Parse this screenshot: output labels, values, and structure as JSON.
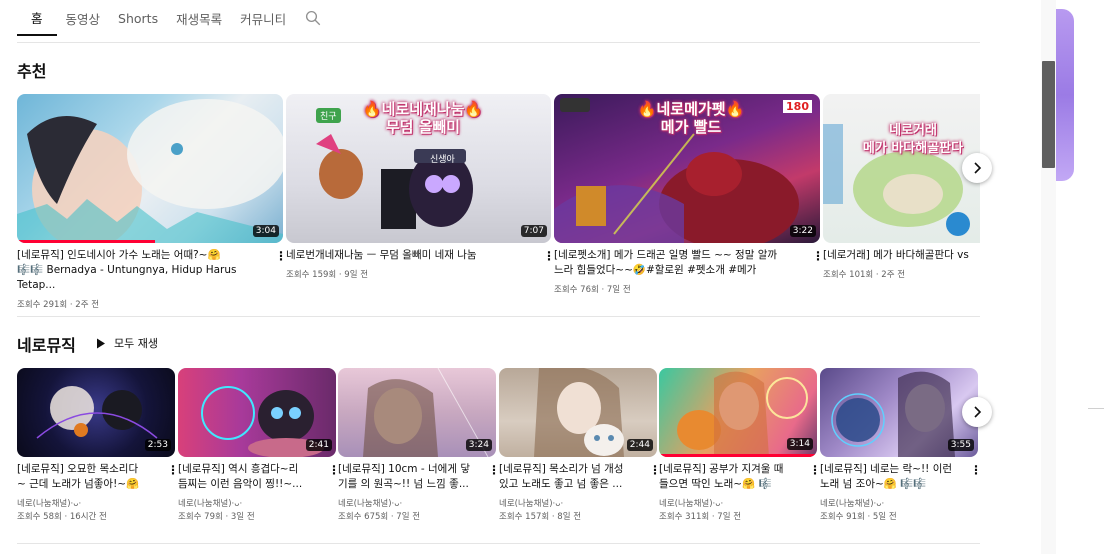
{
  "tabs": [
    {
      "label": "홈",
      "active": true
    },
    {
      "label": "동영상",
      "active": false
    },
    {
      "label": "Shorts",
      "active": false
    },
    {
      "label": "재생목록",
      "active": false
    },
    {
      "label": "커뮤니티",
      "active": false
    }
  ],
  "search_icon": "search-icon",
  "recommended": {
    "title": "추천",
    "videos": [
      {
        "title_line1": "[네로뮤직] 인도네시아 가수 노래는 어때?~🤗",
        "title_line2": "🎼🎼 Bernadya - Untungnya, Hidup Harus Tetap...",
        "meta": "조회수 291회 · 2주 전",
        "duration": "3:04",
        "progress": 0.52
      },
      {
        "title_line1": "네로번개네재나눔 ㅡ 무덤 올빼미 네재 나눔",
        "title_line2": "",
        "meta": "조회수 159회 · 9일 전",
        "duration": "7:07",
        "overlay": "🔥네로네재나눔🔥\n무덤 올빼미",
        "tags": [
          "친구",
          "신생아"
        ]
      },
      {
        "title_line1": "[네로펫소개] 메가 드래곤 일명 빨드 ~~ 정말 알까",
        "title_line2": "느라 힘들었다~~🤣#할로윈 #펫소개 #메가",
        "meta": "조회수 76회 · 7일 전",
        "duration": "3:22",
        "overlay": "🔥네로메가펫🔥\n메가 빨드",
        "counter": "180"
      },
      {
        "title_line1": "[네로거래] 메가 바다해골판다 vs",
        "title_line2": "",
        "meta": "조회수 101회 · 2주 전",
        "overlay": "네로거래\n메가 바다해골판다"
      }
    ]
  },
  "playlist": {
    "title": "네로뮤직",
    "play_all": "모두 재생",
    "videos": [
      {
        "title_line1": "[네로뮤직] 오묘한 목소리다",
        "title_line2": "~ 근데 노래가 넘좋아!~🤗",
        "channel": "네로(나눔채널)·ᴗ·",
        "meta": "조회수 58회 · 16시간 전",
        "duration": "2:53"
      },
      {
        "title_line1": "[네로뮤직] 역시 흥겹다~리",
        "title_line2": "듬찌는 이런 음악이 찡!!~...",
        "channel": "네로(나눔채널)·ᴗ·",
        "meta": "조회수 79회 · 3일 전",
        "duration": "2:41"
      },
      {
        "title_line1": "[네로뮤직] 10cm - 너에게 닿",
        "title_line2": "기를 의 원곡~!! 넘 느낌 좋...",
        "channel": "네로(나눔채널)·ᴗ·",
        "meta": "조회수 675회 · 7일 전",
        "duration": "3:24"
      },
      {
        "title_line1": "[네로뮤직] 목소리가 넘 개성",
        "title_line2": "있고 노래도 좋고 넘 좋은 ...",
        "channel": "네로(나눔채널)·ᴗ·",
        "meta": "조회수 157회 · 8일 전",
        "duration": "2:44"
      },
      {
        "title_line1": "[네로뮤직] 공부가 지겨울 때",
        "title_line2": "들으면 딱인 노래~🤗 🎼",
        "channel": "네로(나눔채널)·ᴗ·",
        "meta": "조회수 311회 · 7일 전",
        "duration": "3:14"
      },
      {
        "title_line1": "[네로뮤직] 네로는 락~!! 이런",
        "title_line2": "노래 넘 조아~🤗 🎼🎼",
        "channel": "네로(나눔채널)·ᴗ·",
        "meta": "조회수 91회 · 5일 전",
        "duration": "3:55"
      }
    ]
  },
  "colors": {
    "accent": "#ff0033",
    "text": "#0f0f0f",
    "muted": "#606060"
  }
}
